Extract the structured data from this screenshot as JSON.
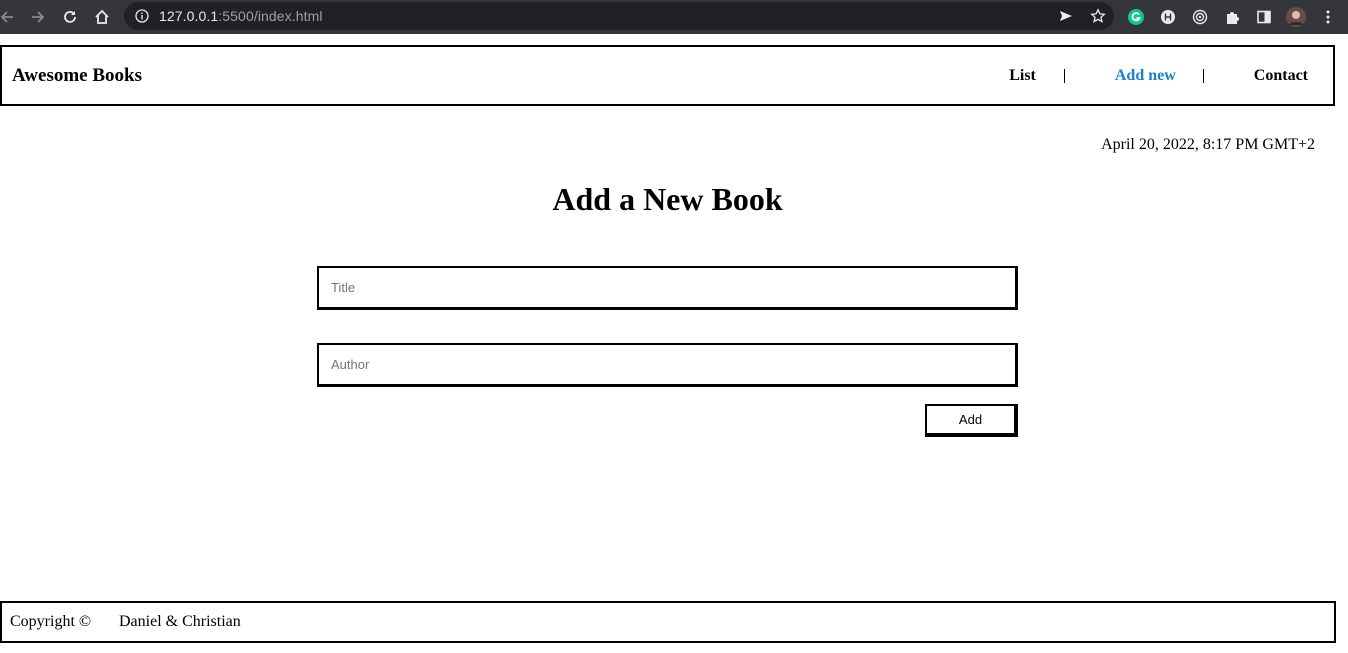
{
  "browser": {
    "url_host": "127.0.0.1",
    "url_rest": ":5500/index.html"
  },
  "header": {
    "brand": "Awesome Books",
    "nav": [
      {
        "label": "List"
      },
      {
        "label": "Add new"
      },
      {
        "label": "Contact"
      }
    ],
    "active_nav_color": "#1a80c9"
  },
  "date": "April 20, 2022, 8:17 PM GMT+2",
  "form": {
    "title": "Add a New Book",
    "title_placeholder": "Title",
    "author_placeholder": "Author",
    "submit_label": "Add"
  },
  "footer": {
    "copyright": "Copyright ©",
    "authors": "Daniel & Christian"
  }
}
